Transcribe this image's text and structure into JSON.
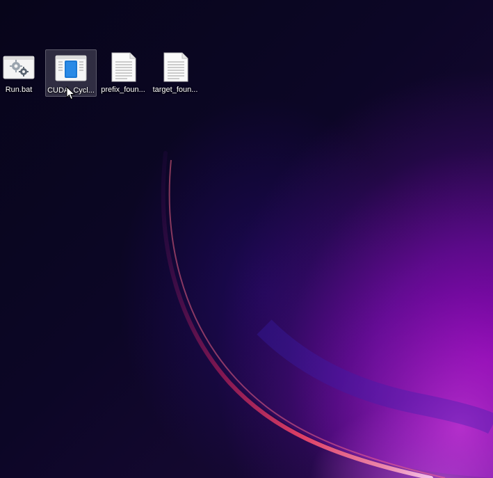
{
  "desktop": {
    "icons": [
      {
        "label": "Run.bat",
        "icon": "batch-file-gear-icon"
      },
      {
        "label": "CUDA_Cycl...",
        "icon": "application-window-icon"
      },
      {
        "label": "prefix_foun...",
        "icon": "text-document-icon"
      },
      {
        "label": "target_foun...",
        "icon": "text-document-icon"
      }
    ],
    "selected_index": 1
  },
  "colors": {
    "background_dark": "#0c0626",
    "accent_magenta": "#a010c8",
    "swirl_edge": "#ff4a6a",
    "selection": "rgba(255,255,255,0.16)"
  }
}
